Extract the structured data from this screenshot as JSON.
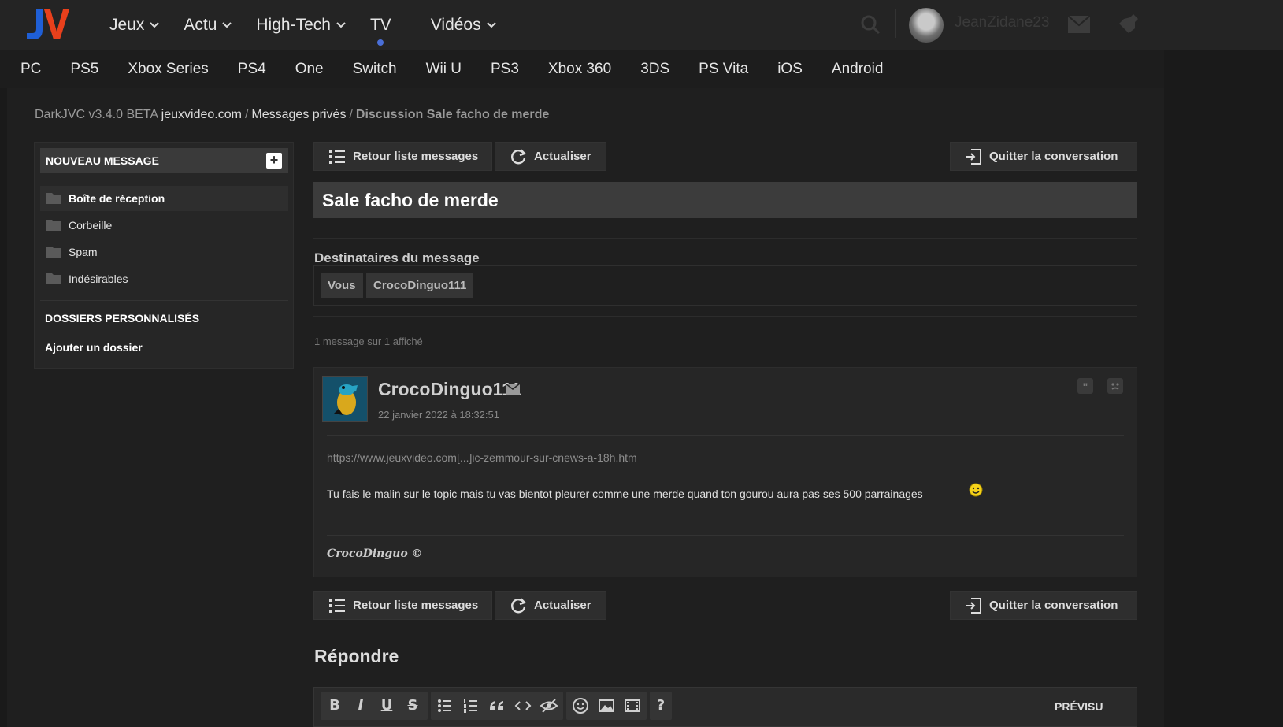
{
  "nav": {
    "items": [
      {
        "label": "Jeux"
      },
      {
        "label": "Actu"
      },
      {
        "label": "High-Tech"
      },
      {
        "label": "TV"
      },
      {
        "label": "Vidéos"
      }
    ],
    "username": "JeanZidane23"
  },
  "platforms": [
    "PC",
    "PS5",
    "Xbox Series",
    "PS4",
    "One",
    "Switch",
    "Wii U",
    "PS3",
    "Xbox 360",
    "3DS",
    "PS Vita",
    "iOS",
    "Android"
  ],
  "breadcrumb": {
    "part1": "DarkJVC v3.4.0 BETA",
    "part2": "jeuxvideo.com",
    "part3": "Messages privés",
    "part4": "Discussion Sale facho de merde",
    "sep": "/"
  },
  "sidebar": {
    "new_message": "NOUVEAU MESSAGE",
    "plus": "+",
    "folders": [
      {
        "label": "Boîte de réception"
      },
      {
        "label": "Corbeille"
      },
      {
        "label": "Spam"
      },
      {
        "label": "Indésirables"
      }
    ],
    "custom_folders_heading": "DOSSIERS PERSONNALISÉS",
    "add_folder": "Ajouter un dossier"
  },
  "actions": {
    "back": "Retour liste messages",
    "refresh": "Actualiser",
    "leave": "Quitter la conversation"
  },
  "discussion": {
    "title": "Sale facho de merde",
    "recipients_label": "Destinataires du message",
    "recipients": [
      "Vous",
      "CrocoDinguo111"
    ],
    "count_text": "1 message sur 1 affiché"
  },
  "message": {
    "author": "CrocoDinguo111",
    "date": "22 janvier 2022 à 18:32:51",
    "link": "https://www.jeuxvideo.com[...]ic-zemmour-sur-cnews-a-18h.htm",
    "body": "Tu fais le malin sur le topic mais tu vas bientot pleurer comme une merde quand ton gourou aura pas ses 500 parrainages",
    "quote_symbol": "\"",
    "signature": "CrocoDinguo ©"
  },
  "reply": {
    "heading": "Répondre",
    "toolbar": {
      "bold": "B",
      "italic": "I",
      "underline": "U",
      "strike": "S",
      "help": "?",
      "preview": "PRÉVISU"
    }
  },
  "colors": {
    "brand_blue": "#1f5fd6",
    "brand_red": "#e8401c",
    "accent_dot": "#4a6fd8"
  }
}
